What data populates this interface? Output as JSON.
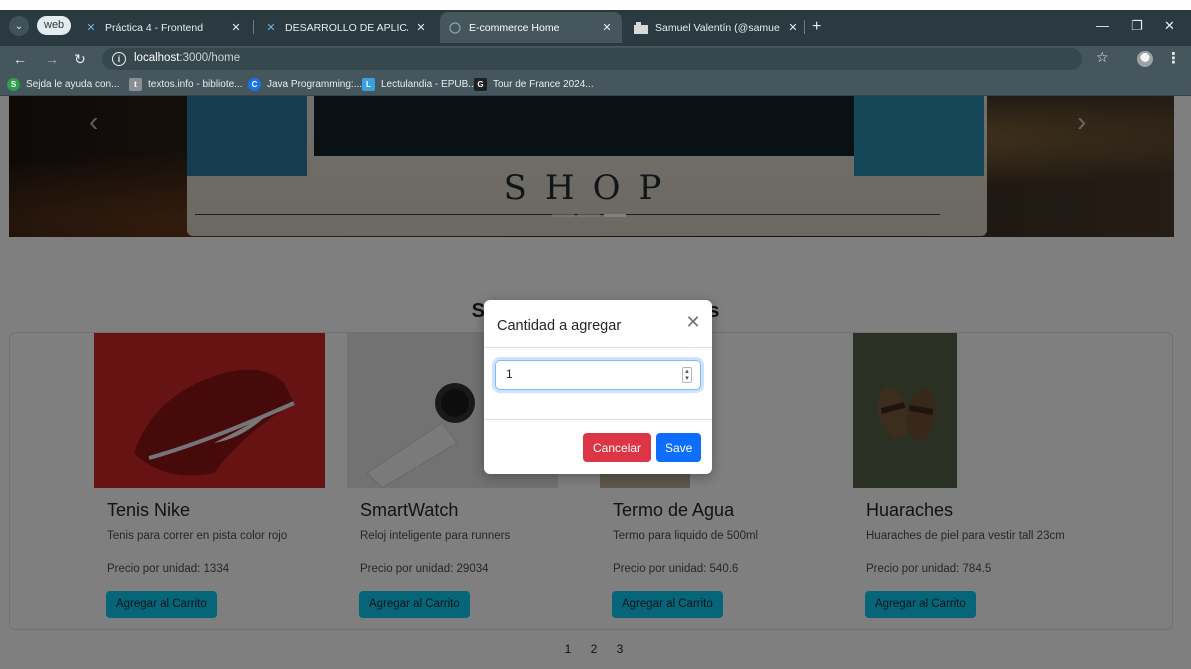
{
  "browser": {
    "profile_label": "web",
    "tabs": [
      {
        "title": "Práctica 4 - Frontend",
        "icon": "vscode-icon"
      },
      {
        "title": "DESARROLLO DE APLICACIONE",
        "icon": "vscode-icon"
      },
      {
        "title": "E-commerce Home",
        "icon": "globe-icon"
      },
      {
        "title": "Samuel Valentín (@samuel_vale",
        "icon": "instagram-icon"
      }
    ],
    "url_host": "localhost",
    "url_path": ":3000/home",
    "bookmarks": [
      {
        "label": "Sejda le ayuda con...",
        "color": "#2e9e4f",
        "glyph": "S"
      },
      {
        "label": "textos.info - bibliote...",
        "color": "#8a8f93",
        "glyph": "t"
      },
      {
        "label": "Java Programming:...",
        "color": "#1a73e8",
        "glyph": "C"
      },
      {
        "label": "Lectulandia - EPUB...",
        "color": "#3aa0e0",
        "glyph": "L"
      },
      {
        "label": "Tour de France 2024...",
        "color": "#202020",
        "glyph": "G"
      }
    ]
  },
  "hero": {
    "shop_text": "SHOP"
  },
  "section": {
    "title": "Seleccione sus productos"
  },
  "products": [
    {
      "name": "Tenis Nike",
      "description": "Tenis para correr en pista color rojo",
      "price_label": "Precio por unidad: 1334",
      "button": "Agregar al Carrito"
    },
    {
      "name": "SmartWatch",
      "description": "Reloj inteligente para runners",
      "price_label": "Precio por unidad: 29034",
      "button": "Agregar al Carrito"
    },
    {
      "name": "Termo de Agua",
      "description": "Termo para liquido de 500ml",
      "price_label": "Precio por unidad: 540.6",
      "button": "Agregar al Carrito"
    },
    {
      "name": "Huaraches",
      "description": "Huaraches de piel para vestir tall 23cm",
      "price_label": "Precio por unidad: 784.5",
      "button": "Agregar al Carrito"
    }
  ],
  "pagination": [
    "1",
    "2",
    "3"
  ],
  "modal": {
    "title": "Cantidad a agregar",
    "quantity": "1",
    "cancel_label": "Cancelar",
    "save_label": "Save"
  },
  "colors": {
    "info_button": "#0dcaf0",
    "cancel_button": "#dc3545",
    "save_button": "#0d6efd"
  }
}
